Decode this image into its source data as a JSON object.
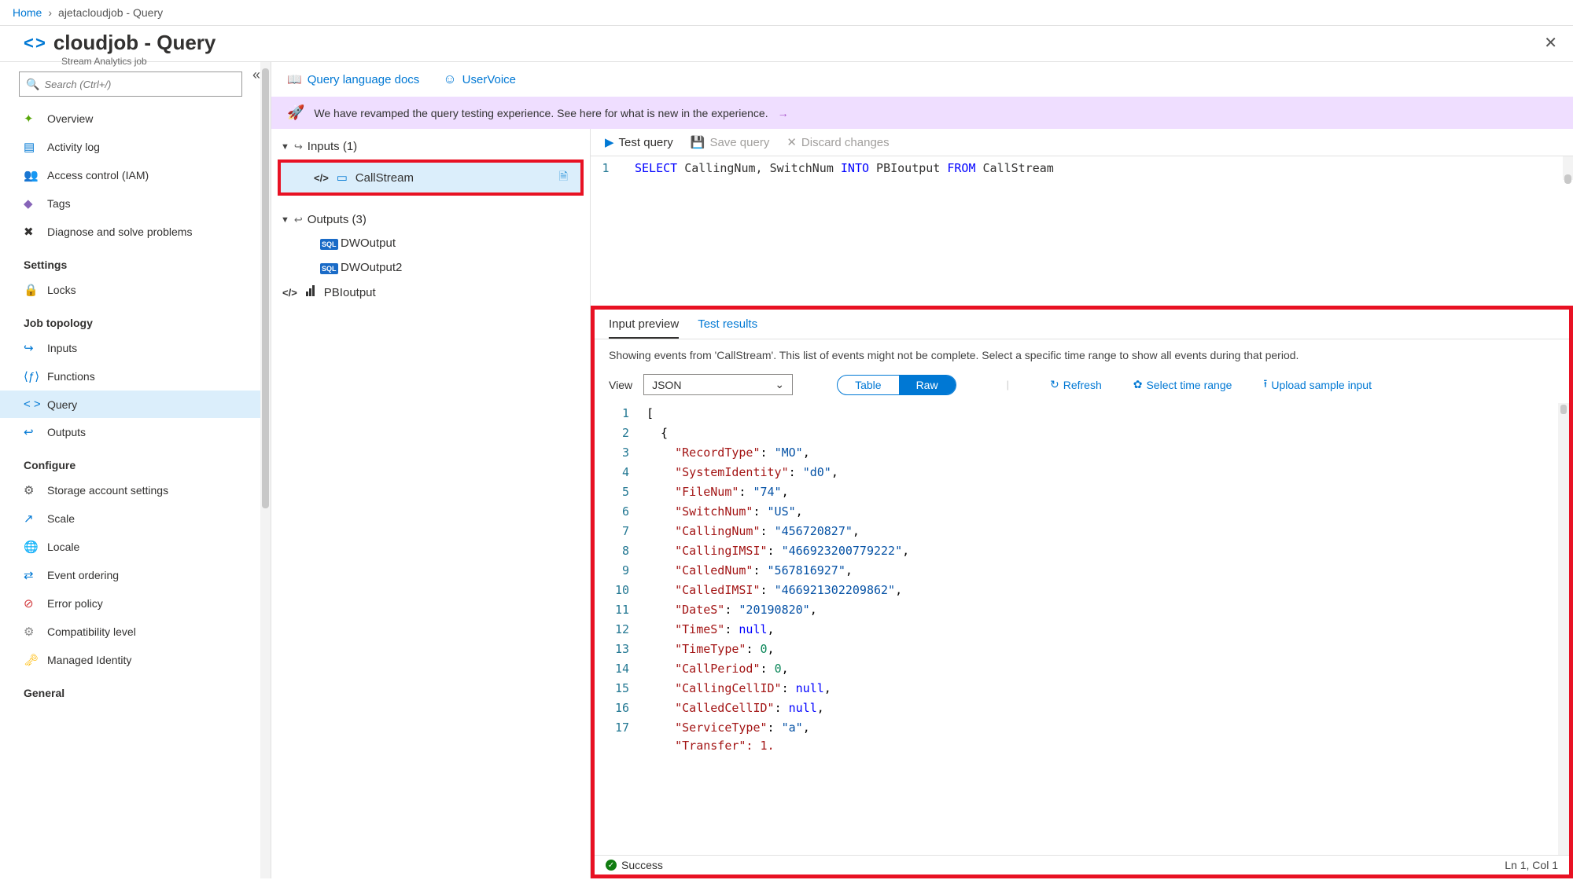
{
  "breadcrumb": {
    "home": "Home",
    "current": "ajetacloudjob - Query"
  },
  "header": {
    "icon": "< >",
    "title": "cloudjob - Query",
    "subtitle": "Stream Analytics job"
  },
  "search": {
    "placeholder": "Search (Ctrl+/)"
  },
  "sidebar": {
    "topItems": [
      {
        "icon": "✦",
        "label": "Overview",
        "name": "overview",
        "color": "#59a70a"
      },
      {
        "icon": "▤",
        "label": "Activity log",
        "name": "activity-log",
        "color": "#0078d4"
      },
      {
        "icon": "👥",
        "label": "Access control (IAM)",
        "name": "access-control",
        "color": "#0078d4"
      },
      {
        "icon": "◆",
        "label": "Tags",
        "name": "tags",
        "color": "#8764b8"
      },
      {
        "icon": "✖",
        "label": "Diagnose and solve problems",
        "name": "diagnose",
        "color": "#323130"
      }
    ],
    "groups": [
      {
        "heading": "Settings",
        "items": [
          {
            "icon": "🔒",
            "label": "Locks",
            "name": "locks",
            "color": "#323130"
          }
        ]
      },
      {
        "heading": "Job topology",
        "items": [
          {
            "icon": "↪",
            "label": "Inputs",
            "name": "inputs",
            "color": "#0078d4"
          },
          {
            "icon": "⟨ƒ⟩",
            "label": "Functions",
            "name": "functions",
            "color": "#0078d4"
          },
          {
            "icon": "< >",
            "label": "Query",
            "name": "query",
            "color": "#0078d4",
            "active": true
          },
          {
            "icon": "↩",
            "label": "Outputs",
            "name": "outputs",
            "color": "#0078d4"
          }
        ]
      },
      {
        "heading": "Configure",
        "items": [
          {
            "icon": "⚙",
            "label": "Storage account settings",
            "name": "storage",
            "color": "#555"
          },
          {
            "icon": "↗",
            "label": "Scale",
            "name": "scale",
            "color": "#0078d4"
          },
          {
            "icon": "🌐",
            "label": "Locale",
            "name": "locale",
            "color": "#c39b00"
          },
          {
            "icon": "⇄",
            "label": "Event ordering",
            "name": "event-ordering",
            "color": "#0078d4"
          },
          {
            "icon": "⊘",
            "label": "Error policy",
            "name": "error-policy",
            "color": "#d13438"
          },
          {
            "icon": "⚙",
            "label": "Compatibility level",
            "name": "compat",
            "color": "#888"
          },
          {
            "icon": "🗝",
            "label": "Managed Identity",
            "name": "managed-identity",
            "color": "#ffb900"
          }
        ]
      },
      {
        "heading": "General",
        "items": []
      }
    ]
  },
  "toolbar": {
    "docs": "Query language docs",
    "uservoice": "UserVoice"
  },
  "banner": {
    "text": "We have revamped the query testing experience. See here for what is new in the experience."
  },
  "tree": {
    "inputsLabel": "Inputs (1)",
    "inputs": [
      {
        "name": "CallStream",
        "selected": true
      }
    ],
    "outputsLabel": "Outputs (3)",
    "outputs": [
      {
        "name": "DWOutput",
        "type": "sql"
      },
      {
        "name": "DWOutput2",
        "type": "sql"
      },
      {
        "name": "PBIoutput",
        "type": "pbi"
      }
    ]
  },
  "queryBar": {
    "test": "Test query",
    "save": "Save query",
    "discard": "Discard changes"
  },
  "editor": {
    "line1": "1",
    "tokens": [
      "SELECT",
      " CallingNum, SwitchNum ",
      "INTO",
      " PBIoutput ",
      "FROM",
      " CallStream"
    ]
  },
  "preview": {
    "tabs": {
      "input": "Input preview",
      "results": "Test results"
    },
    "desc": "Showing events from 'CallStream'. This list of events might not be complete. Select a specific time range to show all events during that period.",
    "viewLabel": "View",
    "viewSelected": "JSON",
    "toggle": {
      "table": "Table",
      "raw": "Raw"
    },
    "actions": {
      "refresh": "Refresh",
      "timeRange": "Select time range",
      "upload": "Upload sample input"
    },
    "jsonLines": [
      {
        "n": 1,
        "txt": "["
      },
      {
        "n": 2,
        "txt": "  {"
      },
      {
        "n": 3,
        "k": "RecordType",
        "v": "\"MO\"",
        "t": "str"
      },
      {
        "n": 4,
        "k": "SystemIdentity",
        "v": "\"d0\"",
        "t": "str"
      },
      {
        "n": 5,
        "k": "FileNum",
        "v": "\"74\"",
        "t": "str"
      },
      {
        "n": 6,
        "k": "SwitchNum",
        "v": "\"US\"",
        "t": "str"
      },
      {
        "n": 7,
        "k": "CallingNum",
        "v": "\"456720827\"",
        "t": "str"
      },
      {
        "n": 8,
        "k": "CallingIMSI",
        "v": "\"466923200779222\"",
        "t": "str"
      },
      {
        "n": 9,
        "k": "CalledNum",
        "v": "\"567816927\"",
        "t": "str"
      },
      {
        "n": 10,
        "k": "CalledIMSI",
        "v": "\"466921302209862\"",
        "t": "str"
      },
      {
        "n": 11,
        "k": "DateS",
        "v": "\"20190820\"",
        "t": "str"
      },
      {
        "n": 12,
        "k": "TimeS",
        "v": "null",
        "t": "null"
      },
      {
        "n": 13,
        "k": "TimeType",
        "v": "0",
        "t": "num"
      },
      {
        "n": 14,
        "k": "CallPeriod",
        "v": "0",
        "t": "num"
      },
      {
        "n": 15,
        "k": "CallingCellID",
        "v": "null",
        "t": "null"
      },
      {
        "n": 16,
        "k": "CalledCellID",
        "v": "null",
        "t": "null"
      },
      {
        "n": 17,
        "k": "ServiceType",
        "v": "\"a\"",
        "t": "str"
      }
    ],
    "cutLine": "    \"Transfer\": 1,",
    "status": "Success",
    "cursor": "Ln 1, Col 1"
  }
}
